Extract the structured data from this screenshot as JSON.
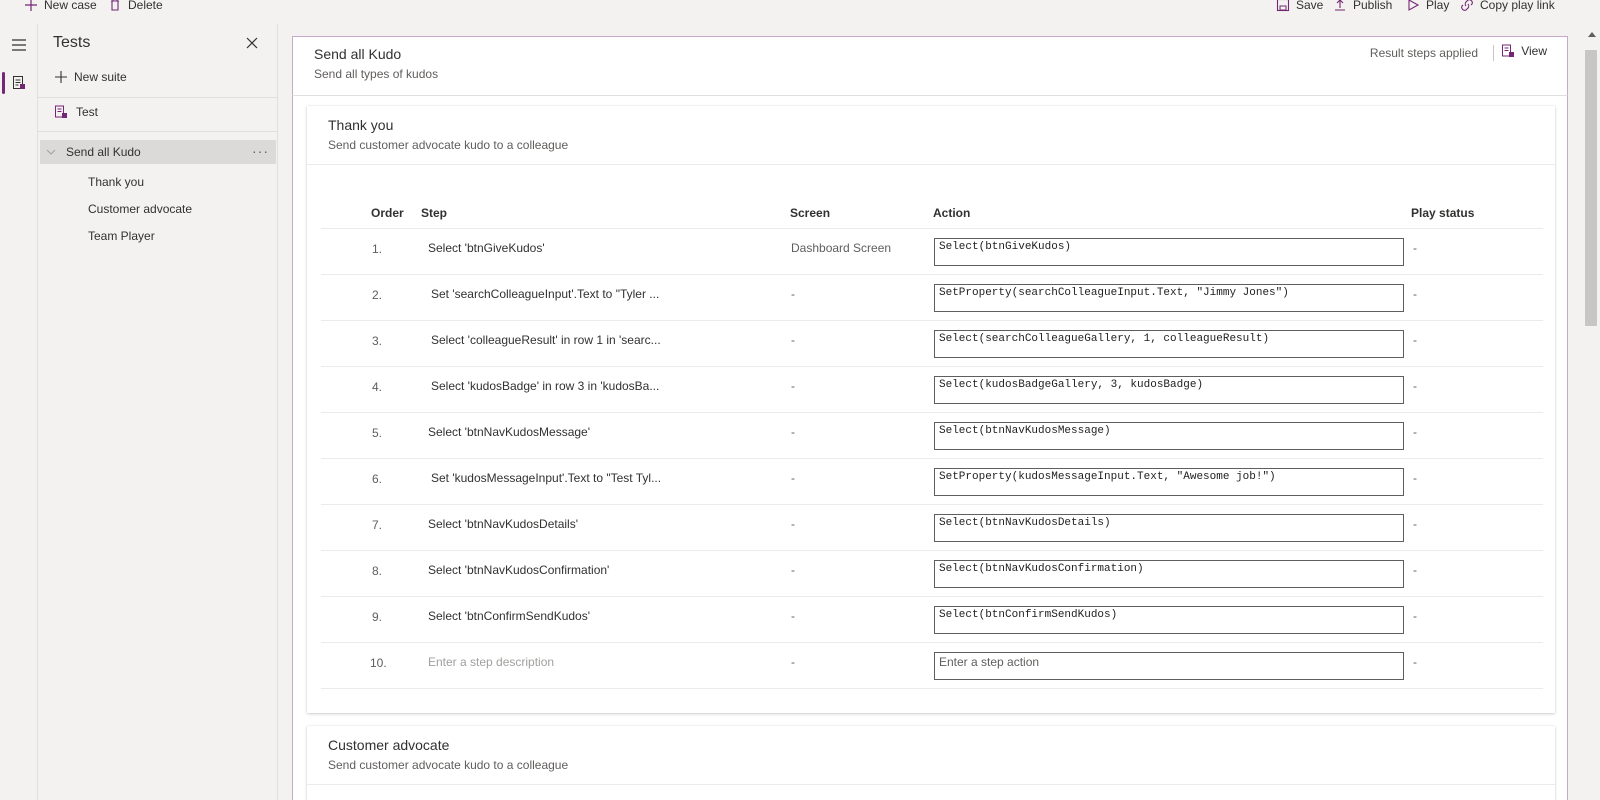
{
  "commandbar": {
    "new_case": "New case",
    "delete": "Delete",
    "save": "Save",
    "publish": "Publish",
    "play": "Play",
    "copy_play_link": "Copy play link"
  },
  "panel": {
    "title": "Tests",
    "new_suite": "New suite",
    "test": "Test",
    "suite": "Send all Kudo",
    "cases": [
      "Thank you",
      "Customer advocate",
      "Team Player"
    ]
  },
  "suite": {
    "name": "Send all Kudo",
    "description": "Send all types of kudos",
    "result_status": "Result steps applied",
    "view_label": "View"
  },
  "case1": {
    "title": "Thank you",
    "description": "Send customer advocate kudo to a colleague",
    "columns": {
      "order": "Order",
      "step": "Step",
      "screen": "Screen",
      "action": "Action",
      "play_status": "Play status"
    },
    "rows": [
      {
        "order": "1.",
        "step": "Select 'btnGiveKudos'",
        "screen": "Dashboard Screen",
        "action": "Select(btnGiveKudos)",
        "status": "-"
      },
      {
        "order": "2.",
        "step": "Set 'searchColleagueInput'.Text to \"Tyler ...",
        "screen": "-",
        "action": "SetProperty(searchColleagueInput.Text, \"Jimmy Jones\")",
        "status": "-"
      },
      {
        "order": "3.",
        "step": "Select 'colleagueResult' in row 1 in 'searc...",
        "screen": "-",
        "action": "Select(searchColleagueGallery, 1, colleagueResult)",
        "status": "-"
      },
      {
        "order": "4.",
        "step": "Select 'kudosBadge' in row 3 in 'kudosBa...",
        "screen": "-",
        "action": "Select(kudosBadgeGallery, 3, kudosBadge)",
        "status": "-"
      },
      {
        "order": "5.",
        "step": "Select 'btnNavKudosMessage'",
        "screen": "-",
        "action": "Select(btnNavKudosMessage)",
        "status": "-"
      },
      {
        "order": "6.",
        "step": "Set 'kudosMessageInput'.Text to \"Test Tyl...",
        "screen": "-",
        "action": "SetProperty(kudosMessageInput.Text, \"Awesome job!\")",
        "status": "-"
      },
      {
        "order": "7.",
        "step": "Select 'btnNavKudosDetails'",
        "screen": "-",
        "action": "Select(btnNavKudosDetails)",
        "status": "-"
      },
      {
        "order": "8.",
        "step": "Select 'btnNavKudosConfirmation'",
        "screen": "-",
        "action": "Select(btnNavKudosConfirmation)",
        "status": "-"
      },
      {
        "order": "9.",
        "step": "Select 'btnConfirmSendKudos'",
        "screen": "-",
        "action": "Select(btnConfirmSendKudos)",
        "status": "-"
      }
    ],
    "new_row": {
      "order": "10.",
      "step_placeholder": "Enter a step description",
      "screen": "-",
      "action_placeholder": "Enter a step action",
      "status": "-"
    }
  },
  "case2": {
    "title": "Customer advocate",
    "description": "Send customer advocate kudo to a colleague"
  },
  "colors": {
    "accent": "#742774",
    "text": "#323130",
    "muted": "#605e5c"
  }
}
